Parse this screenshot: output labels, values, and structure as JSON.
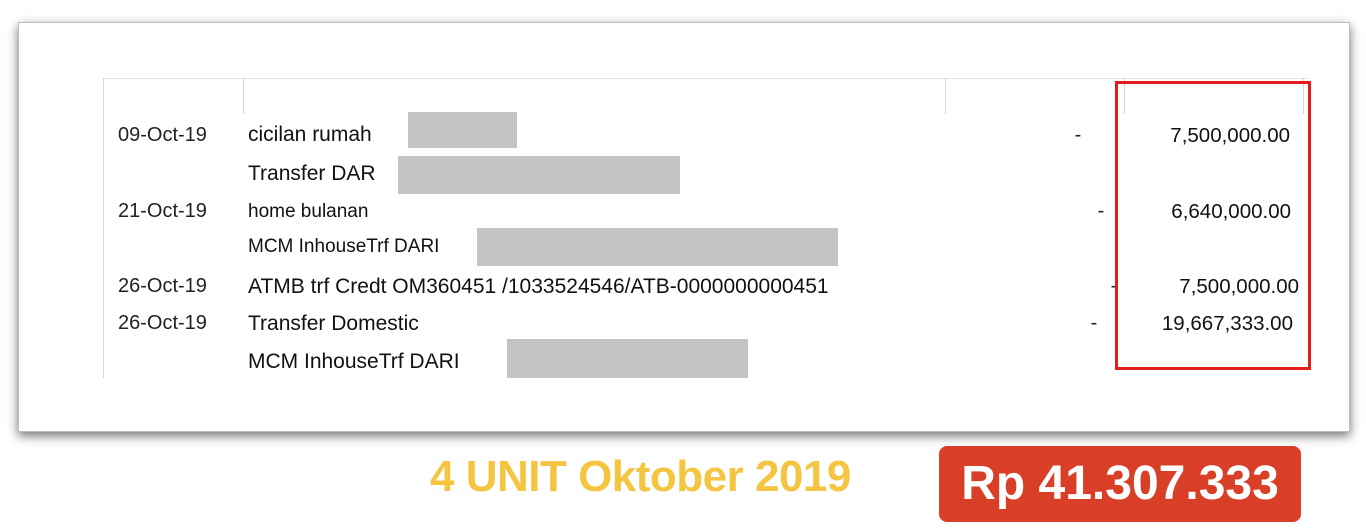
{
  "transactions": [
    {
      "date": "09-Oct-19",
      "description": "cicilan rumah",
      "dash": "-",
      "amount": "7,500,000.00"
    },
    {
      "date": "",
      "description": "Transfer DAR",
      "dash": "",
      "amount": ""
    },
    {
      "date": "21-Oct-19",
      "description": "home bulanan",
      "dash": "-",
      "amount": "6,640,000.00"
    },
    {
      "date": "",
      "description": "MCM InhouseTrf DARI",
      "dash": "",
      "amount": ""
    },
    {
      "date": "26-Oct-19",
      "description": "ATMB trf Credt OM360451 /1033524546/ATB-0000000000451",
      "dash": "-",
      "amount": "7,500,000.00"
    },
    {
      "date": "26-Oct-19",
      "description": "Transfer Domestic",
      "dash": "-",
      "amount": "19,667,333.00"
    },
    {
      "date": "",
      "description": "MCM InhouseTrf DARI",
      "dash": "",
      "amount": ""
    }
  ],
  "caption": "4 UNIT Oktober 2019",
  "total_badge": "Rp 41.307.333",
  "colors": {
    "highlight_box": "#e31c1c",
    "caption": "#f5c542",
    "badge_bg": "#d93f27"
  }
}
